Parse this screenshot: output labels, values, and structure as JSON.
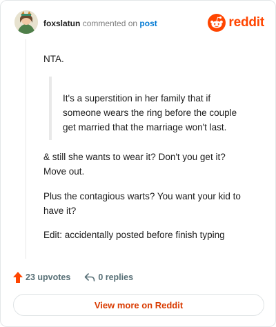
{
  "header": {
    "username": "foxslatun",
    "action_text": "commented on",
    "post_link": "post",
    "brand": "reddit"
  },
  "comment": {
    "line1": "NTA.",
    "quote": "It's a superstition in her family that if someone wears the ring before the couple get married that the marriage won't last.",
    "para1": "& still she wants to wear it? Don't you get it? Move out.",
    "para2": "Plus the contagious warts? You want your kid to have it?",
    "para3": "Edit: accidentally posted before finish typing"
  },
  "footer": {
    "upvotes": "23 upvotes",
    "replies": "0 replies"
  },
  "button": {
    "label": "View more on Reddit"
  },
  "colors": {
    "brand": "#ff4500",
    "link": "#0079d3",
    "upvote": "#ff4500"
  },
  "icons": {
    "brand": "reddit-snoo-icon",
    "upvote": "upvote-arrow-icon",
    "reply": "reply-arrow-icon"
  }
}
